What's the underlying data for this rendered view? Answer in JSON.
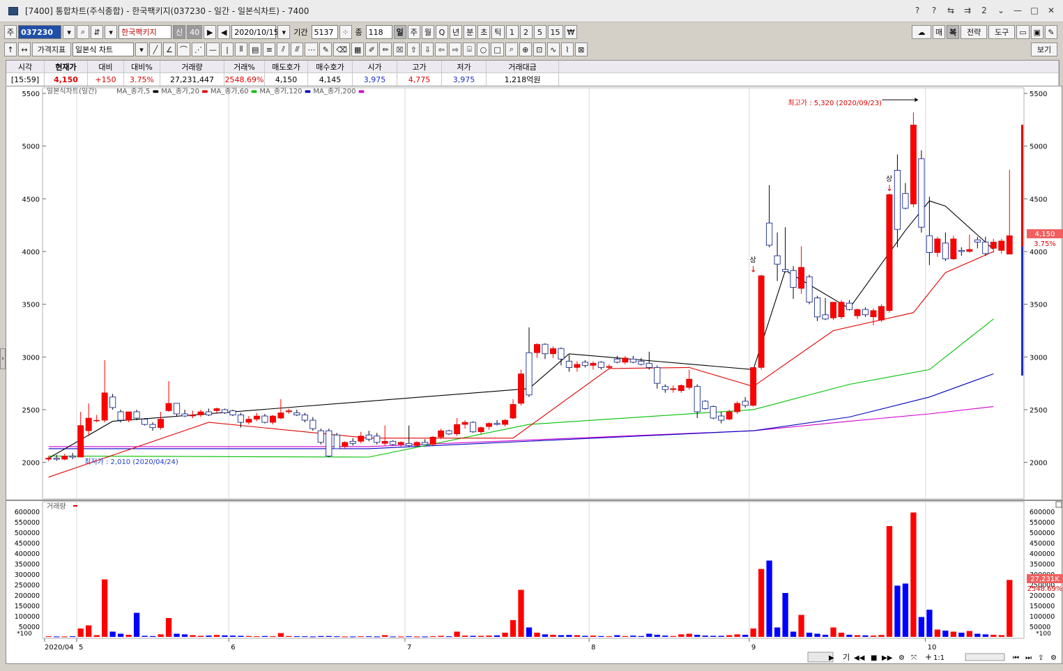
{
  "window": {
    "title": "[7400] 통합차트(주식종합) - 한국팩키지(037230 - 일간 - 일본식차트) - 7400",
    "controls": [
      "?",
      "?",
      "2",
      "—",
      "□",
      "✕"
    ]
  },
  "toolbar1": {
    "market_btn": "주",
    "code": "037230",
    "name": "한국팩키지",
    "credit_badge": "신",
    "credit_ratio": "40",
    "date": "2020/10/15",
    "period_label": "기간",
    "period_value": "5137",
    "count_label": "종",
    "count_value": "118",
    "intervals": [
      "일",
      "주",
      "월",
      "Q",
      "년",
      "분",
      "초",
      "틱",
      "1",
      "2",
      "5",
      "15",
      "₩"
    ],
    "right_buttons": [
      "매",
      "복",
      "전략",
      "도구"
    ]
  },
  "toolbar2": {
    "indicator_btn": "가격지표",
    "chart_type": "일본식 차트",
    "view_btn": "보기"
  },
  "quote": {
    "headers": [
      "시각",
      "현재가",
      "대비",
      "대비%",
      "거래량",
      "거래%",
      "매도호가",
      "매수호가",
      "시가",
      "고가",
      "저가",
      "거래대금"
    ],
    "values": [
      "[15:59]",
      "4,150",
      "+150",
      "3.75%",
      "27,231,447",
      "2548.69%",
      "4,150",
      "4,145",
      "3,975",
      "4,775",
      "3,975",
      "1,218억원"
    ]
  },
  "price_panel": {
    "legend_title": "일본식차트(일간)",
    "legend_items": [
      {
        "label": "MA_종가,5",
        "color": "#000000"
      },
      {
        "label": "MA_종가,20",
        "color": "#e00000"
      },
      {
        "label": "MA_종가,60",
        "color": "#00c000"
      },
      {
        "label": "MA_종가,120",
        "color": "#0000c0"
      },
      {
        "label": "MA_종가,200",
        "color": "#d000d0"
      }
    ],
    "y_ticks": [
      "5500",
      "5000",
      "4500",
      "4000",
      "3500",
      "3000",
      "2500",
      "2000"
    ],
    "high_annotation": "최고가 : 5,320 (2020/09/23)",
    "low_annotation": "최저가 : 2,010 (2020/04/24)",
    "limit_up_label": "상",
    "current_price_tag": "4,150",
    "current_pct_tag": "3.75%"
  },
  "volume_panel": {
    "legend_title": "거래량",
    "y_ticks": [
      "600000",
      "550000",
      "500000",
      "450000",
      "400000",
      "350000",
      "300000",
      "250000",
      "200000",
      "150000",
      "100000",
      "50000"
    ],
    "unit_label": "*100",
    "current_volume_tag": "27,231K",
    "current_pct_tag": "2548.69%"
  },
  "x_axis": {
    "labels": [
      "2020/04",
      "5",
      "6",
      "7",
      "8",
      "9",
      "10"
    ]
  },
  "bottom_controls": {
    "items": [
      "기",
      "◀◀",
      "■",
      "▶▶",
      "1:1",
      "+",
      "−"
    ]
  },
  "colors": {
    "up": "#ff0000",
    "down": "#0000ff",
    "ma5": "#000000",
    "ma20": "#e00000",
    "ma60": "#00c000",
    "ma120": "#0000c0",
    "ma200": "#d000d0"
  },
  "chart_data": {
    "type": "candlestick",
    "period": "daily",
    "symbol": "037230",
    "ylim": [
      1700,
      5500
    ],
    "volume_ylim": [
      0,
      620000
    ],
    "candles": [
      {
        "o": 2030,
        "h": 2060,
        "l": 2010,
        "c": 2040,
        "v": 3000
      },
      {
        "o": 2040,
        "h": 2070,
        "l": 2015,
        "c": 2030,
        "v": 2000
      },
      {
        "o": 2030,
        "h": 2080,
        "l": 2020,
        "c": 2060,
        "v": 2000
      },
      {
        "o": 2060,
        "h": 2090,
        "l": 2030,
        "c": 2050,
        "v": 3000
      },
      {
        "o": 2050,
        "h": 2480,
        "l": 2050,
        "c": 2350,
        "v": 40000
      },
      {
        "o": 2300,
        "h": 2560,
        "l": 2250,
        "c": 2420,
        "v": 55000
      },
      {
        "o": 2400,
        "h": 2450,
        "l": 2380,
        "c": 2400,
        "v": 8000
      },
      {
        "o": 2400,
        "h": 2970,
        "l": 2380,
        "c": 2660,
        "v": 275000
      },
      {
        "o": 2620,
        "h": 2650,
        "l": 2500,
        "c": 2520,
        "v": 25000
      },
      {
        "o": 2480,
        "h": 2500,
        "l": 2380,
        "c": 2400,
        "v": 15000
      },
      {
        "o": 2400,
        "h": 2470,
        "l": 2380,
        "c": 2480,
        "v": 10000
      },
      {
        "o": 2480,
        "h": 2500,
        "l": 2400,
        "c": 2420,
        "v": 115000
      },
      {
        "o": 2410,
        "h": 2420,
        "l": 2350,
        "c": 2360,
        "v": 5000
      },
      {
        "o": 2360,
        "h": 2380,
        "l": 2300,
        "c": 2330,
        "v": 4000
      },
      {
        "o": 2330,
        "h": 2480,
        "l": 2310,
        "c": 2410,
        "v": 12000
      },
      {
        "o": 2490,
        "h": 2770,
        "l": 2480,
        "c": 2560,
        "v": 90000
      },
      {
        "o": 2560,
        "h": 2560,
        "l": 2440,
        "c": 2460,
        "v": 15000
      },
      {
        "o": 2460,
        "h": 2500,
        "l": 2430,
        "c": 2440,
        "v": 12000
      },
      {
        "o": 2440,
        "h": 2490,
        "l": 2420,
        "c": 2450,
        "v": 8000
      },
      {
        "o": 2450,
        "h": 2500,
        "l": 2430,
        "c": 2480,
        "v": 5000
      },
      {
        "o": 2480,
        "h": 2510,
        "l": 2440,
        "c": 2450,
        "v": 6000
      },
      {
        "o": 2490,
        "h": 2520,
        "l": 2470,
        "c": 2510,
        "v": 9000
      },
      {
        "o": 2500,
        "h": 2510,
        "l": 2460,
        "c": 2470,
        "v": 7000
      },
      {
        "o": 2490,
        "h": 2500,
        "l": 2440,
        "c": 2450,
        "v": 6000
      },
      {
        "o": 2450,
        "h": 2470,
        "l": 2330,
        "c": 2380,
        "v": 5000
      },
      {
        "o": 2380,
        "h": 2440,
        "l": 2360,
        "c": 2410,
        "v": 4000
      },
      {
        "o": 2410,
        "h": 2470,
        "l": 2390,
        "c": 2440,
        "v": 3000
      },
      {
        "o": 2440,
        "h": 2460,
        "l": 2370,
        "c": 2380,
        "v": 4000
      },
      {
        "o": 2380,
        "h": 2450,
        "l": 2360,
        "c": 2440,
        "v": 3000
      },
      {
        "o": 2420,
        "h": 2600,
        "l": 2410,
        "c": 2470,
        "v": 18000
      },
      {
        "o": 2480,
        "h": 2510,
        "l": 2460,
        "c": 2490,
        "v": 4000
      },
      {
        "o": 2470,
        "h": 2500,
        "l": 2440,
        "c": 2450,
        "v": 3000
      },
      {
        "o": 2450,
        "h": 2470,
        "l": 2380,
        "c": 2400,
        "v": 3000
      },
      {
        "o": 2400,
        "h": 2430,
        "l": 2300,
        "c": 2320,
        "v": 2000
      },
      {
        "o": 2300,
        "h": 2320,
        "l": 2170,
        "c": 2190,
        "v": 4000
      },
      {
        "o": 2300,
        "h": 2320,
        "l": 2050,
        "c": 2060,
        "v": 4000
      },
      {
        "o": 2260,
        "h": 2280,
        "l": 2130,
        "c": 2130,
        "v": 3000
      },
      {
        "o": 2150,
        "h": 2200,
        "l": 2130,
        "c": 2190,
        "v": 2000
      },
      {
        "o": 2200,
        "h": 2230,
        "l": 2160,
        "c": 2180,
        "v": 2000
      },
      {
        "o": 2200,
        "h": 2290,
        "l": 2180,
        "c": 2250,
        "v": 3000
      },
      {
        "o": 2260,
        "h": 2300,
        "l": 2200,
        "c": 2220,
        "v": 3000
      },
      {
        "o": 2250,
        "h": 2280,
        "l": 2170,
        "c": 2190,
        "v": 2000
      },
      {
        "o": 2180,
        "h": 2350,
        "l": 2160,
        "c": 2200,
        "v": 8000
      },
      {
        "o": 2200,
        "h": 2210,
        "l": 2160,
        "c": 2170,
        "v": 2000
      },
      {
        "o": 2170,
        "h": 2200,
        "l": 2150,
        "c": 2190,
        "v": 2000
      },
      {
        "o": 2180,
        "h": 2350,
        "l": 2150,
        "c": 2160,
        "v": 3000
      },
      {
        "o": 2160,
        "h": 2200,
        "l": 2150,
        "c": 2190,
        "v": 2000
      },
      {
        "o": 2190,
        "h": 2220,
        "l": 2170,
        "c": 2170,
        "v": 2000
      },
      {
        "o": 2170,
        "h": 2250,
        "l": 2160,
        "c": 2240,
        "v": 3000
      },
      {
        "o": 2240,
        "h": 2320,
        "l": 2220,
        "c": 2300,
        "v": 5000
      },
      {
        "o": 2300,
        "h": 2310,
        "l": 2260,
        "c": 2270,
        "v": 3000
      },
      {
        "o": 2270,
        "h": 2420,
        "l": 2250,
        "c": 2360,
        "v": 25000
      },
      {
        "o": 2360,
        "h": 2400,
        "l": 2320,
        "c": 2380,
        "v": 6000
      },
      {
        "o": 2380,
        "h": 2390,
        "l": 2280,
        "c": 2290,
        "v": 5000
      },
      {
        "o": 2290,
        "h": 2340,
        "l": 2270,
        "c": 2330,
        "v": 5000
      },
      {
        "o": 2340,
        "h": 2380,
        "l": 2310,
        "c": 2370,
        "v": 6000
      },
      {
        "o": 2370,
        "h": 2400,
        "l": 2350,
        "c": 2360,
        "v": 7000
      },
      {
        "o": 2360,
        "h": 2410,
        "l": 2340,
        "c": 2400,
        "v": 20000
      },
      {
        "o": 2420,
        "h": 2600,
        "l": 2410,
        "c": 2550,
        "v": 80000
      },
      {
        "o": 2560,
        "h": 2880,
        "l": 2540,
        "c": 2840,
        "v": 225000
      },
      {
        "o": 3040,
        "h": 3280,
        "l": 2620,
        "c": 2640,
        "v": 45000
      },
      {
        "o": 3040,
        "h": 3130,
        "l": 2990,
        "c": 3120,
        "v": 20000
      },
      {
        "o": 3120,
        "h": 3130,
        "l": 2980,
        "c": 3030,
        "v": 12000
      },
      {
        "o": 3030,
        "h": 3100,
        "l": 2990,
        "c": 3080,
        "v": 10000
      },
      {
        "o": 3080,
        "h": 3090,
        "l": 2920,
        "c": 2980,
        "v": 8000
      },
      {
        "o": 2960,
        "h": 3020,
        "l": 2860,
        "c": 2900,
        "v": 9000
      },
      {
        "o": 2900,
        "h": 2960,
        "l": 2860,
        "c": 2930,
        "v": 8000
      },
      {
        "o": 2950,
        "h": 2970,
        "l": 2900,
        "c": 2920,
        "v": 5000
      },
      {
        "o": 2920,
        "h": 2960,
        "l": 2880,
        "c": 2940,
        "v": 6000
      },
      {
        "o": 2950,
        "h": 2960,
        "l": 2880,
        "c": 2900,
        "v": 4000
      },
      {
        "o": 2900,
        "h": 2930,
        "l": 2880,
        "c": 2910,
        "v": 3000
      },
      {
        "o": 2980,
        "h": 3010,
        "l": 2940,
        "c": 2950,
        "v": 8000
      },
      {
        "o": 2950,
        "h": 3010,
        "l": 2930,
        "c": 2990,
        "v": 4000
      },
      {
        "o": 2980,
        "h": 3010,
        "l": 2940,
        "c": 2950,
        "v": 6000
      },
      {
        "o": 2960,
        "h": 2990,
        "l": 2920,
        "c": 2930,
        "v": 4000
      },
      {
        "o": 2940,
        "h": 3050,
        "l": 2880,
        "c": 2900,
        "v": 15000
      },
      {
        "o": 2900,
        "h": 2920,
        "l": 2700,
        "c": 2750,
        "v": 10000
      },
      {
        "o": 2720,
        "h": 2740,
        "l": 2660,
        "c": 2690,
        "v": 6000
      },
      {
        "o": 2690,
        "h": 2730,
        "l": 2660,
        "c": 2700,
        "v": 4000
      },
      {
        "o": 2680,
        "h": 2740,
        "l": 2660,
        "c": 2730,
        "v": 12000
      },
      {
        "o": 2710,
        "h": 2880,
        "l": 2690,
        "c": 2790,
        "v": 15000
      },
      {
        "o": 2720,
        "h": 2740,
        "l": 2420,
        "c": 2480,
        "v": 10000
      },
      {
        "o": 2580,
        "h": 2590,
        "l": 2500,
        "c": 2510,
        "v": 6000
      },
      {
        "o": 2530,
        "h": 2540,
        "l": 2410,
        "c": 2420,
        "v": 5000
      },
      {
        "o": 2440,
        "h": 2480,
        "l": 2370,
        "c": 2400,
        "v": 5000
      },
      {
        "o": 2410,
        "h": 2500,
        "l": 2400,
        "c": 2480,
        "v": 8000
      },
      {
        "o": 2480,
        "h": 2580,
        "l": 2460,
        "c": 2560,
        "v": 12000
      },
      {
        "o": 2580,
        "h": 2620,
        "l": 2520,
        "c": 2540,
        "v": 10000
      },
      {
        "o": 2540,
        "h": 2900,
        "l": 2530,
        "c": 2900,
        "v": 40000
      },
      {
        "o": 2900,
        "h": 3780,
        "l": 2880,
        "c": 3770,
        "v": 325000
      },
      {
        "o": 4270,
        "h": 4630,
        "l": 4040,
        "c": 4060,
        "v": 365000
      },
      {
        "o": 3960,
        "h": 4180,
        "l": 3720,
        "c": 3880,
        "v": 45000
      },
      {
        "o": 3830,
        "h": 4230,
        "l": 3800,
        "c": 3810,
        "v": 210000
      },
      {
        "o": 3820,
        "h": 3860,
        "l": 3550,
        "c": 3660,
        "v": 25000
      },
      {
        "o": 3650,
        "h": 4050,
        "l": 3600,
        "c": 3850,
        "v": 105000
      },
      {
        "o": 3760,
        "h": 3780,
        "l": 3500,
        "c": 3520,
        "v": 20000
      },
      {
        "o": 3560,
        "h": 3580,
        "l": 3340,
        "c": 3380,
        "v": 15000
      },
      {
        "o": 3400,
        "h": 3560,
        "l": 3350,
        "c": 3360,
        "v": 10000
      },
      {
        "o": 3370,
        "h": 3400,
        "l": 3350,
        "c": 3520,
        "v": 45000
      },
      {
        "o": 3380,
        "h": 3540,
        "l": 3360,
        "c": 3520,
        "v": 20000
      },
      {
        "o": 3510,
        "h": 3540,
        "l": 3440,
        "c": 3450,
        "v": 10000
      },
      {
        "o": 3390,
        "h": 3460,
        "l": 3360,
        "c": 3450,
        "v": 8000
      },
      {
        "o": 3450,
        "h": 3470,
        "l": 3380,
        "c": 3400,
        "v": 7000
      },
      {
        "o": 3380,
        "h": 3460,
        "l": 3300,
        "c": 3440,
        "v": 6000
      },
      {
        "o": 3350,
        "h": 3500,
        "l": 3330,
        "c": 3480,
        "v": 9000
      },
      {
        "o": 3440,
        "h": 4550,
        "l": 3420,
        "c": 4540,
        "v": 530000
      },
      {
        "o": 4770,
        "h": 4920,
        "l": 4040,
        "c": 4210,
        "v": 245000
      },
      {
        "o": 4550,
        "h": 4650,
        "l": 4400,
        "c": 4410,
        "v": 255000
      },
      {
        "o": 4450,
        "h": 5320,
        "l": 4420,
        "c": 5200,
        "v": 595000
      },
      {
        "o": 4880,
        "h": 4960,
        "l": 4180,
        "c": 4230,
        "v": 95000
      },
      {
        "o": 4150,
        "h": 4520,
        "l": 3870,
        "c": 3990,
        "v": 130000
      },
      {
        "o": 3990,
        "h": 4140,
        "l": 3950,
        "c": 4120,
        "v": 35000
      },
      {
        "o": 4080,
        "h": 4180,
        "l": 3910,
        "c": 3930,
        "v": 30000
      },
      {
        "o": 3930,
        "h": 4150,
        "l": 3920,
        "c": 4120,
        "v": 25000
      },
      {
        "o": 4010,
        "h": 4040,
        "l": 3960,
        "c": 4000,
        "v": 20000
      },
      {
        "o": 4000,
        "h": 4160,
        "l": 3990,
        "c": 4020,
        "v": 28000
      },
      {
        "o": 4110,
        "h": 4140,
        "l": 4030,
        "c": 4090,
        "v": 15000
      },
      {
        "o": 4090,
        "h": 4140,
        "l": 3960,
        "c": 3980,
        "v": 12000
      },
      {
        "o": 4030,
        "h": 4120,
        "l": 3990,
        "c": 4090,
        "v": 10000
      },
      {
        "o": 4010,
        "h": 4120,
        "l": 3980,
        "c": 4100,
        "v": 8000
      },
      {
        "o": 3975,
        "h": 4775,
        "l": 3975,
        "c": 4150,
        "v": 272314
      }
    ],
    "ma5_endpoints": [
      [
        0,
        2040
      ],
      [
        8,
        2390
      ],
      [
        60,
        2700
      ],
      [
        65,
        3030
      ],
      [
        88,
        2880
      ],
      [
        92,
        3820
      ],
      [
        100,
        3460
      ],
      [
        107,
        4200
      ],
      [
        110,
        4480
      ],
      [
        112,
        4430
      ],
      [
        118,
        4020
      ]
    ],
    "ma20_endpoints": [
      [
        0,
        1860
      ],
      [
        20,
        2380
      ],
      [
        40,
        2230
      ],
      [
        58,
        2230
      ],
      [
        70,
        2890
      ],
      [
        80,
        2900
      ],
      [
        88,
        2720
      ],
      [
        98,
        3250
      ],
      [
        108,
        3420
      ],
      [
        112,
        3800
      ],
      [
        118,
        4000
      ]
    ],
    "ma60_endpoints": [
      [
        0,
        2060
      ],
      [
        40,
        2050
      ],
      [
        60,
        2360
      ],
      [
        88,
        2500
      ],
      [
        100,
        2740
      ],
      [
        110,
        2880
      ],
      [
        118,
        3360
      ]
    ],
    "ma120_endpoints": [
      [
        0,
        2130
      ],
      [
        40,
        2130
      ],
      [
        88,
        2300
      ],
      [
        100,
        2430
      ],
      [
        110,
        2620
      ],
      [
        118,
        2840
      ]
    ],
    "ma200_endpoints": [
      [
        0,
        2150
      ],
      [
        40,
        2150
      ],
      [
        88,
        2300
      ],
      [
        100,
        2390
      ],
      [
        110,
        2460
      ],
      [
        118,
        2530
      ]
    ]
  }
}
